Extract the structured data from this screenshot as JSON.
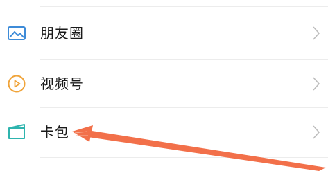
{
  "menu": {
    "items": [
      {
        "label": "朋友圈",
        "icon": "moments-icon",
        "icon_color": "#3d8bd8"
      },
      {
        "label": "视频号",
        "icon": "channels-icon",
        "icon_color": "#f0a43a"
      },
      {
        "label": "卡包",
        "icon": "card-wallet-icon",
        "icon_color": "#2eb4ae"
      }
    ],
    "chevron_icon": "chevron-right-icon",
    "chevron_color": "#bdbdbd",
    "divider_color": "#ececec"
  },
  "annotation": {
    "icon": "red-arrow-icon",
    "color": "#f2704a"
  }
}
